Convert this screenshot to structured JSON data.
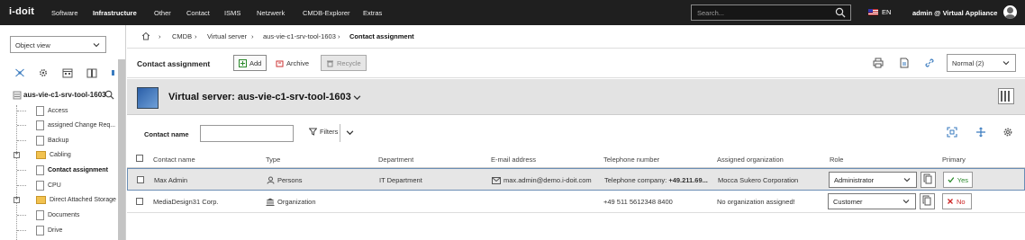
{
  "topbar": {
    "logo": "i-doit",
    "nav": [
      "Software",
      "Infrastructure",
      "Other",
      "Contact",
      "ISMS",
      "Netzwerk",
      "CMDB-Explorer",
      "Extras"
    ],
    "active_nav": "Infrastructure",
    "search_placeholder": "Search...",
    "language": "EN",
    "user": "admin @ Virtual Appliance"
  },
  "sidebar": {
    "view_select": "Object view",
    "root": "aus-vie-c1-srv-tool-1603",
    "items": [
      {
        "label": "Access",
        "type": "doc"
      },
      {
        "label": "assigned Change Req...",
        "type": "doc"
      },
      {
        "label": "Backup",
        "type": "doc"
      },
      {
        "label": "Cabling",
        "type": "folder"
      },
      {
        "label": "Contact assignment",
        "type": "doc"
      },
      {
        "label": "CPU",
        "type": "doc"
      },
      {
        "label": "Direct Attached Storage",
        "type": "folder"
      },
      {
        "label": "Documents",
        "type": "doc"
      },
      {
        "label": "Drive",
        "type": "doc"
      }
    ]
  },
  "breadcrumb": [
    "CMDB",
    "Virtual server",
    "aus-vie-c1-srv-tool-1603",
    "Contact assignment"
  ],
  "toolbar": {
    "title": "Contact assignment",
    "add": "Add",
    "archive": "Archive",
    "recycle": "Recycle",
    "view_mode": "Normal (2)"
  },
  "object": {
    "title": "Virtual server: aus-vie-c1-srv-tool-1603"
  },
  "filter": {
    "label": "Contact name",
    "filters_button": "Filters"
  },
  "table": {
    "headers": [
      "Contact name",
      "Type",
      "Department",
      "E-mail address",
      "Telephone number",
      "Assigned organization",
      "Role",
      "Primary"
    ],
    "rows": [
      {
        "contact_name": "Max Admin",
        "type": "Persons",
        "department": "IT Department",
        "email": "max.admin@demo.i-doit.com",
        "telephone_prefix": "Telephone company:",
        "telephone_value": "+49.211.69...",
        "organization": "Mocca Sukero Corporation",
        "role": "Administrator",
        "primary": "Yes"
      },
      {
        "contact_name": "MediaDesign31 Corp.",
        "type": "Organization",
        "department": "",
        "email": "",
        "telephone_prefix": "",
        "telephone_value": "+49 511 5612348 8400",
        "organization": "No organization assigned!",
        "role": "Customer",
        "primary": "No"
      }
    ]
  },
  "colors": {
    "topbar_bg": "#1f1f1f",
    "selected_row_border": "#6b8eb5",
    "yes_green": "#2a8a2a",
    "no_red": "#cc2222"
  }
}
